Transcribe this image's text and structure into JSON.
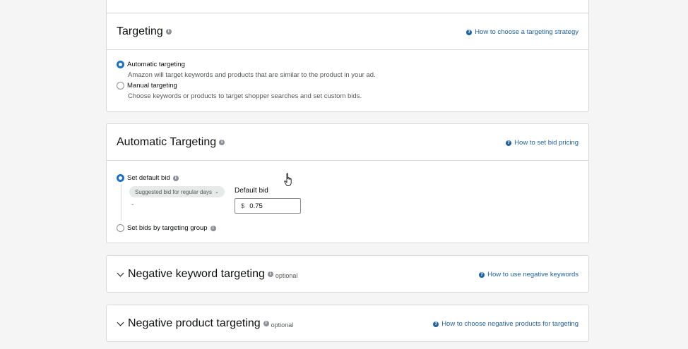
{
  "targeting": {
    "title": "Targeting",
    "help": "How to choose a targeting strategy",
    "options": [
      {
        "label": "Automatic targeting",
        "desc": "Amazon will target keywords and products that are similar to the product in your ad.",
        "checked": true
      },
      {
        "label": "Manual targeting",
        "desc": "Choose keywords or products to target shopper searches and set custom bids.",
        "checked": false
      }
    ]
  },
  "auto": {
    "title": "Automatic Targeting",
    "help": "How to set bid pricing",
    "default_bid_option": "Set default bid",
    "suggested_pill": "Suggested bid for regular days",
    "suggested_value": "-",
    "default_bid_label": "Default bid",
    "currency": "$",
    "bid_value": "0.75",
    "group_option": "Set bids by targeting group"
  },
  "neg_keyword": {
    "title": "Negative keyword targeting",
    "optional": "optional",
    "help": "How to use negative keywords"
  },
  "neg_product": {
    "title": "Negative product targeting",
    "optional": "optional",
    "help": "How to choose negative products for targeting"
  },
  "icons": {
    "info": "i",
    "help": "?"
  },
  "colors": {
    "link": "#2162a1",
    "radio_selected": "#1a73c8",
    "border": "#d5d9d9",
    "page_bg": "#f5f5f5"
  }
}
